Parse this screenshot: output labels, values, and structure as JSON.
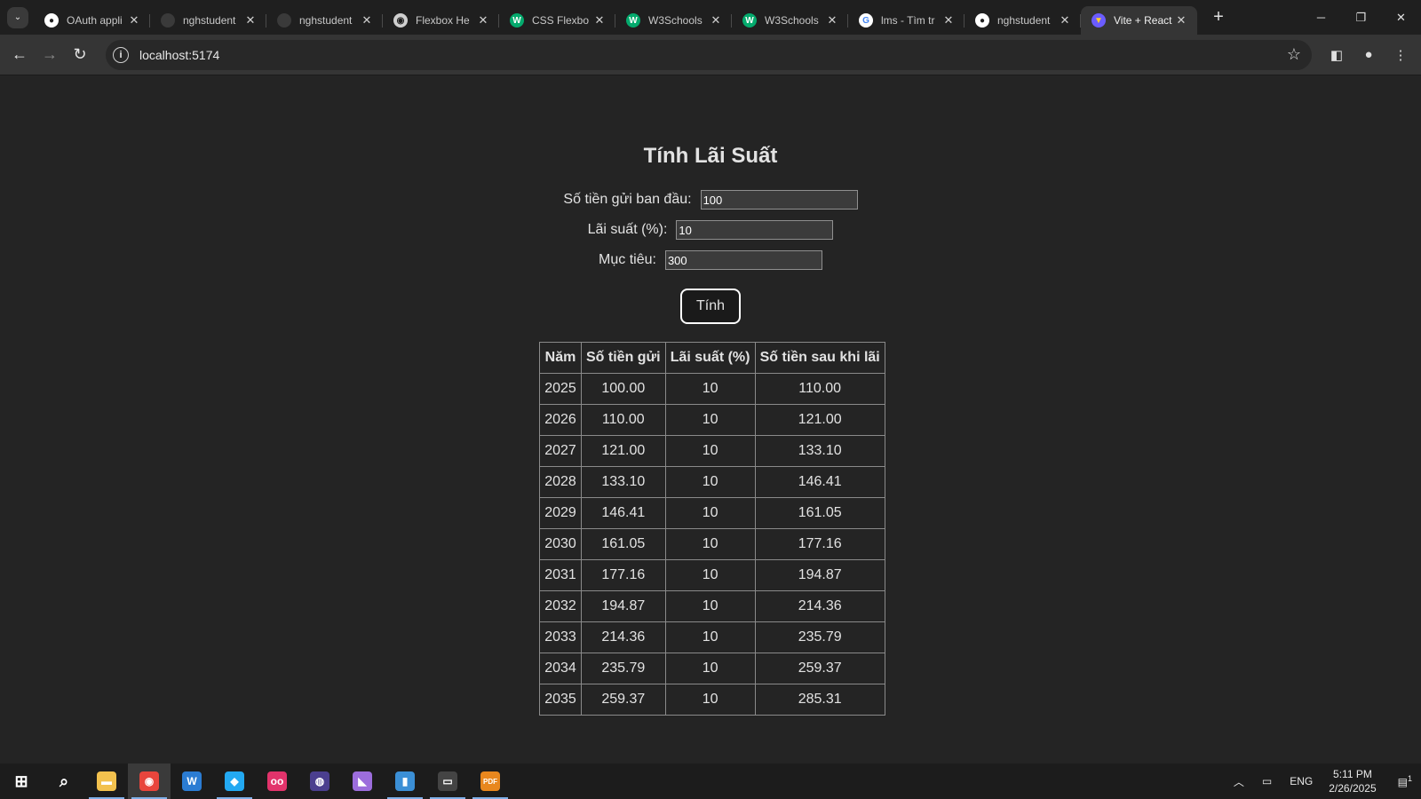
{
  "browser": {
    "tabs": [
      {
        "title": "OAuth appli",
        "icon": "github-icon",
        "icon_text": "●",
        "color": "#ffffff",
        "fg": "#1f1f1f"
      },
      {
        "title": "nghstudent",
        "icon": "github-icon",
        "icon_text": "",
        "color": "#3a3a3a",
        "fg": "#1f1f1f"
      },
      {
        "title": "nghstudent",
        "icon": "github-icon",
        "icon_text": "",
        "color": "#3a3a3a",
        "fg": "#1f1f1f"
      },
      {
        "title": "Flexbox He",
        "icon": "globe-icon",
        "icon_text": "◉",
        "color": "#cfcfcf",
        "fg": "#1f1f1f"
      },
      {
        "title": "CSS Flexbo",
        "icon": "w3schools-icon",
        "icon_text": "W",
        "color": "#04aa6d",
        "fg": "#ffffff"
      },
      {
        "title": "W3Schools",
        "icon": "w3schools-icon",
        "icon_text": "W",
        "color": "#04aa6d",
        "fg": "#ffffff"
      },
      {
        "title": "W3Schools",
        "icon": "w3schools-icon",
        "icon_text": "W",
        "color": "#04aa6d",
        "fg": "#ffffff"
      },
      {
        "title": "lms - Tìm tr",
        "icon": "google-icon",
        "icon_text": "G",
        "color": "#ffffff",
        "fg": "#4285f4"
      },
      {
        "title": "nghstudent",
        "icon": "github-icon",
        "icon_text": "●",
        "color": "#ffffff",
        "fg": "#1f1f1f"
      },
      {
        "title": "Vite + React",
        "icon": "vite-icon",
        "icon_text": "▼",
        "color": "#6b5cff",
        "fg": "#ffd028",
        "active": true
      }
    ],
    "new_tab": "+",
    "url": "localhost:5174"
  },
  "page": {
    "title": "Tính Lãi Suất",
    "fields": [
      {
        "label": "Số tiền gửi ban đầu:",
        "value": "100"
      },
      {
        "label": "Lãi suất (%):",
        "value": "10"
      },
      {
        "label": "Mục tiêu:",
        "value": "300"
      }
    ],
    "button": "Tính",
    "table": {
      "headers": [
        "Năm",
        "Số tiền gửi",
        "Lãi suất (%)",
        "Số tiền sau khi lãi"
      ],
      "rows": [
        [
          "2025",
          "100.00",
          "10",
          "110.00"
        ],
        [
          "2026",
          "110.00",
          "10",
          "121.00"
        ],
        [
          "2027",
          "121.00",
          "10",
          "133.10"
        ],
        [
          "2028",
          "133.10",
          "10",
          "146.41"
        ],
        [
          "2029",
          "146.41",
          "10",
          "161.05"
        ],
        [
          "2030",
          "161.05",
          "10",
          "177.16"
        ],
        [
          "2031",
          "177.16",
          "10",
          "194.87"
        ],
        [
          "2032",
          "194.87",
          "10",
          "214.36"
        ],
        [
          "2033",
          "214.36",
          "10",
          "235.79"
        ],
        [
          "2034",
          "235.79",
          "10",
          "259.37"
        ],
        [
          "2035",
          "259.37",
          "10",
          "285.31"
        ]
      ]
    }
  },
  "taskbar": {
    "apps": [
      {
        "name": "file-explorer-icon",
        "glyph": "▬",
        "color": "#f2c14e",
        "open": true
      },
      {
        "name": "chrome-icon",
        "glyph": "◉",
        "color": "#e8453c",
        "open": true,
        "active": true
      },
      {
        "name": "word-app-icon",
        "glyph": "W",
        "color": "#2b7cd3",
        "open": false
      },
      {
        "name": "vscode-icon",
        "glyph": "◆",
        "color": "#23a9f2",
        "open": true
      },
      {
        "name": "app-oo-icon",
        "glyph": "oo",
        "color": "#e2336b",
        "open": false
      },
      {
        "name": "eclipse-icon",
        "glyph": "◍",
        "color": "#4b3f8f",
        "open": false
      },
      {
        "name": "visual-studio-icon",
        "glyph": "◣",
        "color": "#9c6ddc",
        "open": false
      },
      {
        "name": "app-blue-icon",
        "glyph": "▮",
        "color": "#3b8fd6",
        "open": true
      },
      {
        "name": "terminal-icon",
        "glyph": "▭",
        "color": "#444444",
        "open": true
      },
      {
        "name": "pdf-icon",
        "glyph": "PDF",
        "color": "#e8871e",
        "open": true
      }
    ],
    "language": "ENG",
    "time": "5:11 PM",
    "date": "2/26/2025",
    "notification_count": "1"
  }
}
